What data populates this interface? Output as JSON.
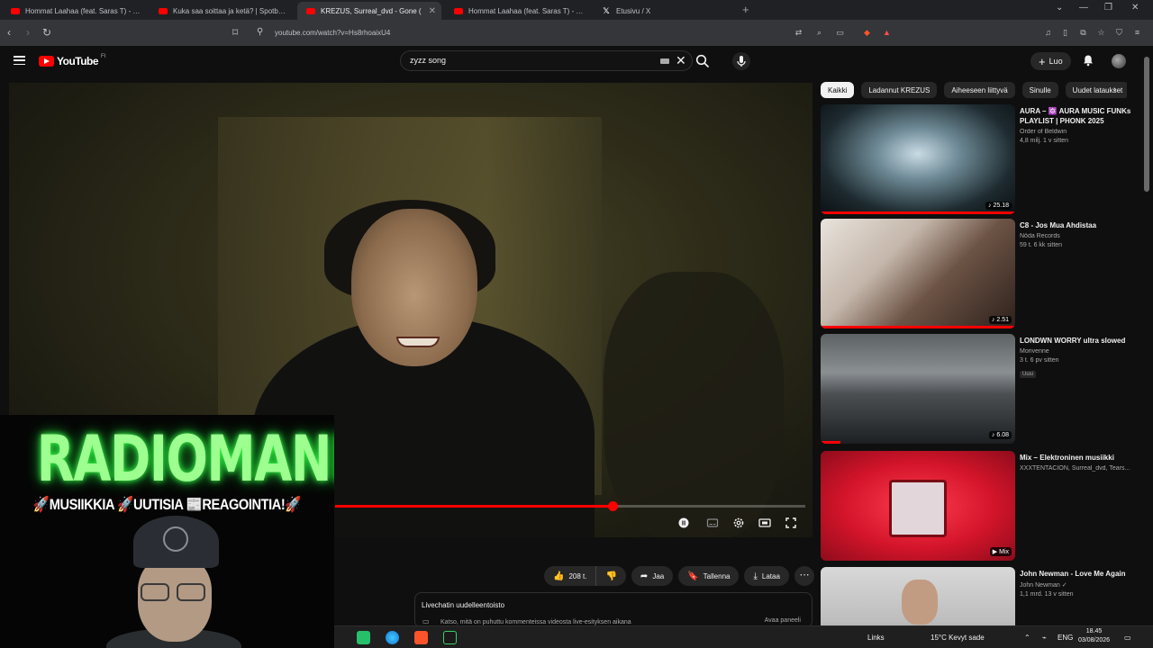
{
  "browser": {
    "tabs": [
      {
        "title": "Hommat Laahaa (feat. Saras T) - You",
        "favicon": "youtube-icon",
        "active": false
      },
      {
        "title": "Kuka saa soittaa ja ketä? | Spotbkarp...",
        "favicon": "youtube-icon",
        "active": false
      },
      {
        "title": "KREZUS, Surreal_dvd - Gone (",
        "favicon": "youtube-icon",
        "active": true
      },
      {
        "title": "Hommat Laahaa (feat. Saras T) - You",
        "favicon": "youtube-icon",
        "active": false
      },
      {
        "title": "Etusivu / X",
        "favicon": "x-icon",
        "active": false
      }
    ],
    "url": "youtube.com/watch?v=Hs8rhoaixU4"
  },
  "youtube": {
    "logo_text": "YouTube",
    "logo_country": "FI",
    "search_value": "zyzz song",
    "create_label": "Luo"
  },
  "player": {
    "progress": 0.59
  },
  "overlay": {
    "title": "RADIOMANE",
    "tagline": "🚀MUSIIKKIA 🚀UUTISIA 📰REAGOINTIA!🚀"
  },
  "actions": {
    "likes": "208 t.",
    "share": "Jaa",
    "save": "Tallenna",
    "download": "Lataa"
  },
  "chat": {
    "title": "Livechatin uudelleentoisto",
    "subtitle": "Katso, mitä on puhuttu kommenteissa videosta live-esityksen aikana",
    "button": "Avaa paneeli"
  },
  "chips": [
    "Kaikki",
    "Ladannut KREZUS",
    "Aiheeseen liittyvä",
    "Sinulle",
    "Uudet lataukset"
  ],
  "recommendations": [
    {
      "title": "AURA – 🔯 AURA MUSIC FUNKs PLAYLIST | PHONK 2025",
      "channel": "Order of Beldwin",
      "meta": "4,8 milj.  1 v sitten",
      "duration": "♪ 25.18",
      "progress": 1.0,
      "badge": ""
    },
    {
      "title": "C8 - Jos Mua Ahdistaa",
      "channel": "Nöda Records",
      "meta": "59 t.  6 kk sitten",
      "duration": "♪ 2.51",
      "progress": 1.0,
      "badge": ""
    },
    {
      "title": "LONDWN WORRY ultra slowed",
      "channel": "Morivenne",
      "meta": "3 t.  6 pv sitten",
      "duration": "♪ 6.08",
      "progress": 0.1,
      "badge": "Uusi"
    },
    {
      "title": "Mix – Elektroninen musiikki",
      "channel": "XXXTENTACION, Surreal_dvd, Tears...",
      "meta": "",
      "duration": "▶ Mix",
      "progress": 0,
      "badge": ""
    },
    {
      "title": "John Newman - Love Me Again",
      "channel": "John Newman ✓",
      "meta": "1,1 mrd.  13 v sitten",
      "duration": "",
      "progress": 0,
      "badge": ""
    }
  ],
  "taskbar": {
    "links_label": "Links",
    "weather": "15°C  Kevyt sade",
    "lang": "ENG",
    "time": "18.45",
    "date": "03/08/2026"
  }
}
